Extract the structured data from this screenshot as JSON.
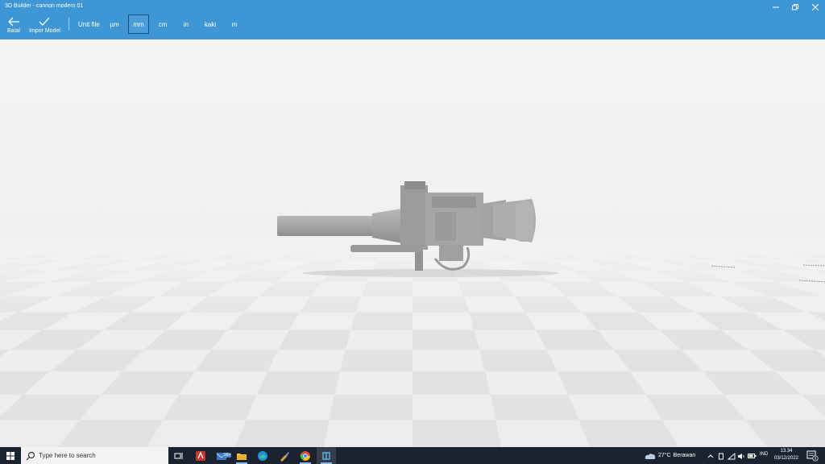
{
  "window": {
    "title": "3D Builder - cannon modern 01"
  },
  "toolbar": {
    "back_label": "Batal",
    "import_label": "Impor Model",
    "unit_label": "Unit file",
    "units": [
      "µm",
      "mm",
      "cm",
      "in",
      "kaki",
      "m"
    ],
    "selected_unit": "mm"
  },
  "taskbar": {
    "search_placeholder": "Type here to search",
    "mail_badge": "99+",
    "weather_temp": "27°C",
    "weather_desc": "Berawan",
    "language": "IND",
    "time": "13.34",
    "date": "03/12/2022",
    "notification_count": "9"
  },
  "colors": {
    "header_bg": "#3e96d5",
    "taskbar_bg": "#1b2330",
    "viewport_bg": "#f2f2f2",
    "model_gray": "#a8a8a8"
  },
  "icons": {
    "back": "arrow-left-icon",
    "import": "checkmark-icon",
    "search": "search-icon",
    "start": "windows-logo-icon",
    "weather": "cloud-icon"
  }
}
